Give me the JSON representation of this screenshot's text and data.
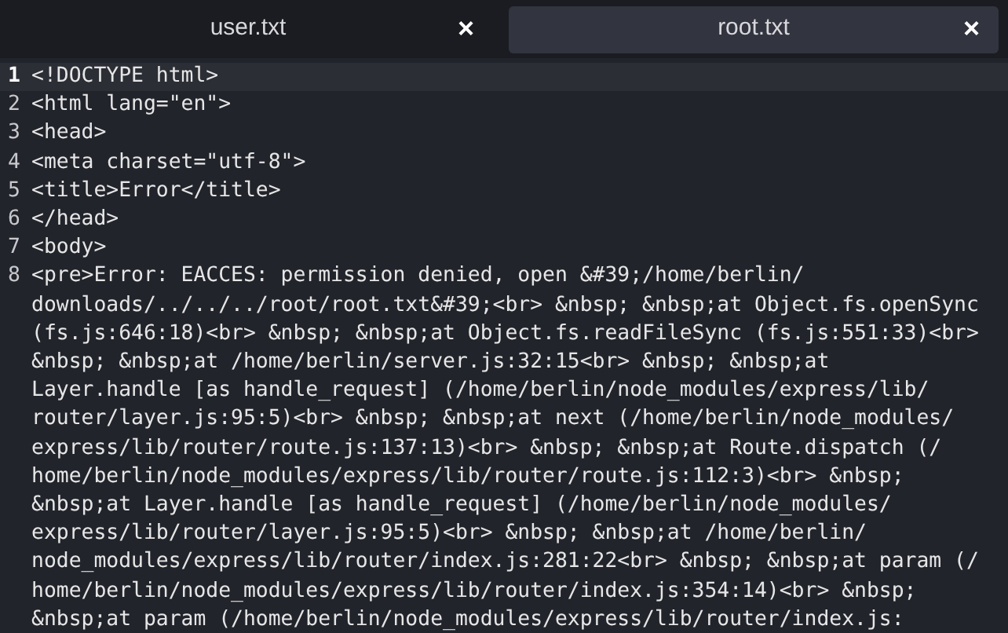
{
  "tabs": [
    {
      "label": "user.txt",
      "selected": false,
      "close": "×"
    },
    {
      "label": "root.txt",
      "selected": true,
      "close": "×"
    }
  ],
  "editor": {
    "lines": [
      {
        "number": "1",
        "current": true,
        "text": [
          "<!DOCTYPE html>"
        ]
      },
      {
        "number": "2",
        "current": false,
        "text": [
          "<html lang=\"en\">"
        ]
      },
      {
        "number": "3",
        "current": false,
        "text": [
          "<head>"
        ]
      },
      {
        "number": "4",
        "current": false,
        "text": [
          "<meta charset=\"utf-8\">"
        ]
      },
      {
        "number": "5",
        "current": false,
        "text": [
          "<title>Error</title>"
        ]
      },
      {
        "number": "6",
        "current": false,
        "text": [
          "</head>"
        ]
      },
      {
        "number": "7",
        "current": false,
        "text": [
          "<body>"
        ]
      },
      {
        "number": "8",
        "current": false,
        "text": [
          "<pre>Error: EACCES: permission denied, open &#39;/home/berlin/",
          "downloads/../../../root/root.txt&#39;<br> &nbsp; &nbsp;at Object.fs.openSync",
          "(fs.js:646:18)<br> &nbsp; &nbsp;at Object.fs.readFileSync (fs.js:551:33)<br>",
          "&nbsp; &nbsp;at /home/berlin/server.js:32:15<br> &nbsp; &nbsp;at",
          "Layer.handle [as handle_request] (/home/berlin/node_modules/express/lib/",
          "router/layer.js:95:5)<br> &nbsp; &nbsp;at next (/home/berlin/node_modules/",
          "express/lib/router/route.js:137:13)<br> &nbsp; &nbsp;at Route.dispatch (/",
          "home/berlin/node_modules/express/lib/router/route.js:112:3)<br> &nbsp;",
          "&nbsp;at Layer.handle [as handle_request] (/home/berlin/node_modules/",
          "express/lib/router/layer.js:95:5)<br> &nbsp; &nbsp;at /home/berlin/",
          "node_modules/express/lib/router/index.js:281:22<br> &nbsp; &nbsp;at param (/",
          "home/berlin/node_modules/express/lib/router/index.js:354:14)<br> &nbsp;",
          "&nbsp;at param (/home/berlin/node_modules/express/lib/router/index.js:"
        ]
      }
    ]
  }
}
